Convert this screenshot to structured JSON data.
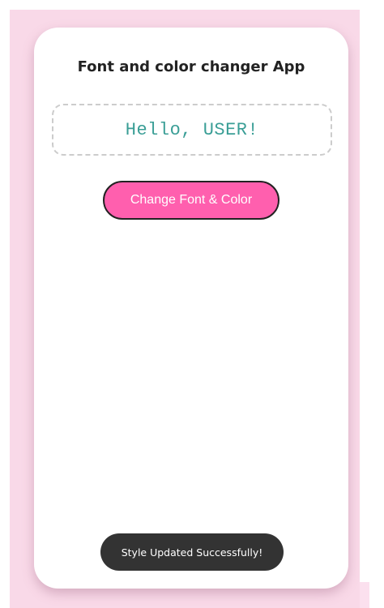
{
  "app": {
    "title": "Font and color changer App"
  },
  "greeting": {
    "text": "Hello, USER!"
  },
  "actions": {
    "change_label": "Change Font & Color"
  },
  "toast": {
    "message": "Style Updated Successfully!"
  },
  "colors": {
    "background": "#f9d9e8",
    "card": "#ffffff",
    "button_fill": "#ff5fae",
    "greeting_text": "#3a9e96",
    "toast_fill": "#333333"
  }
}
